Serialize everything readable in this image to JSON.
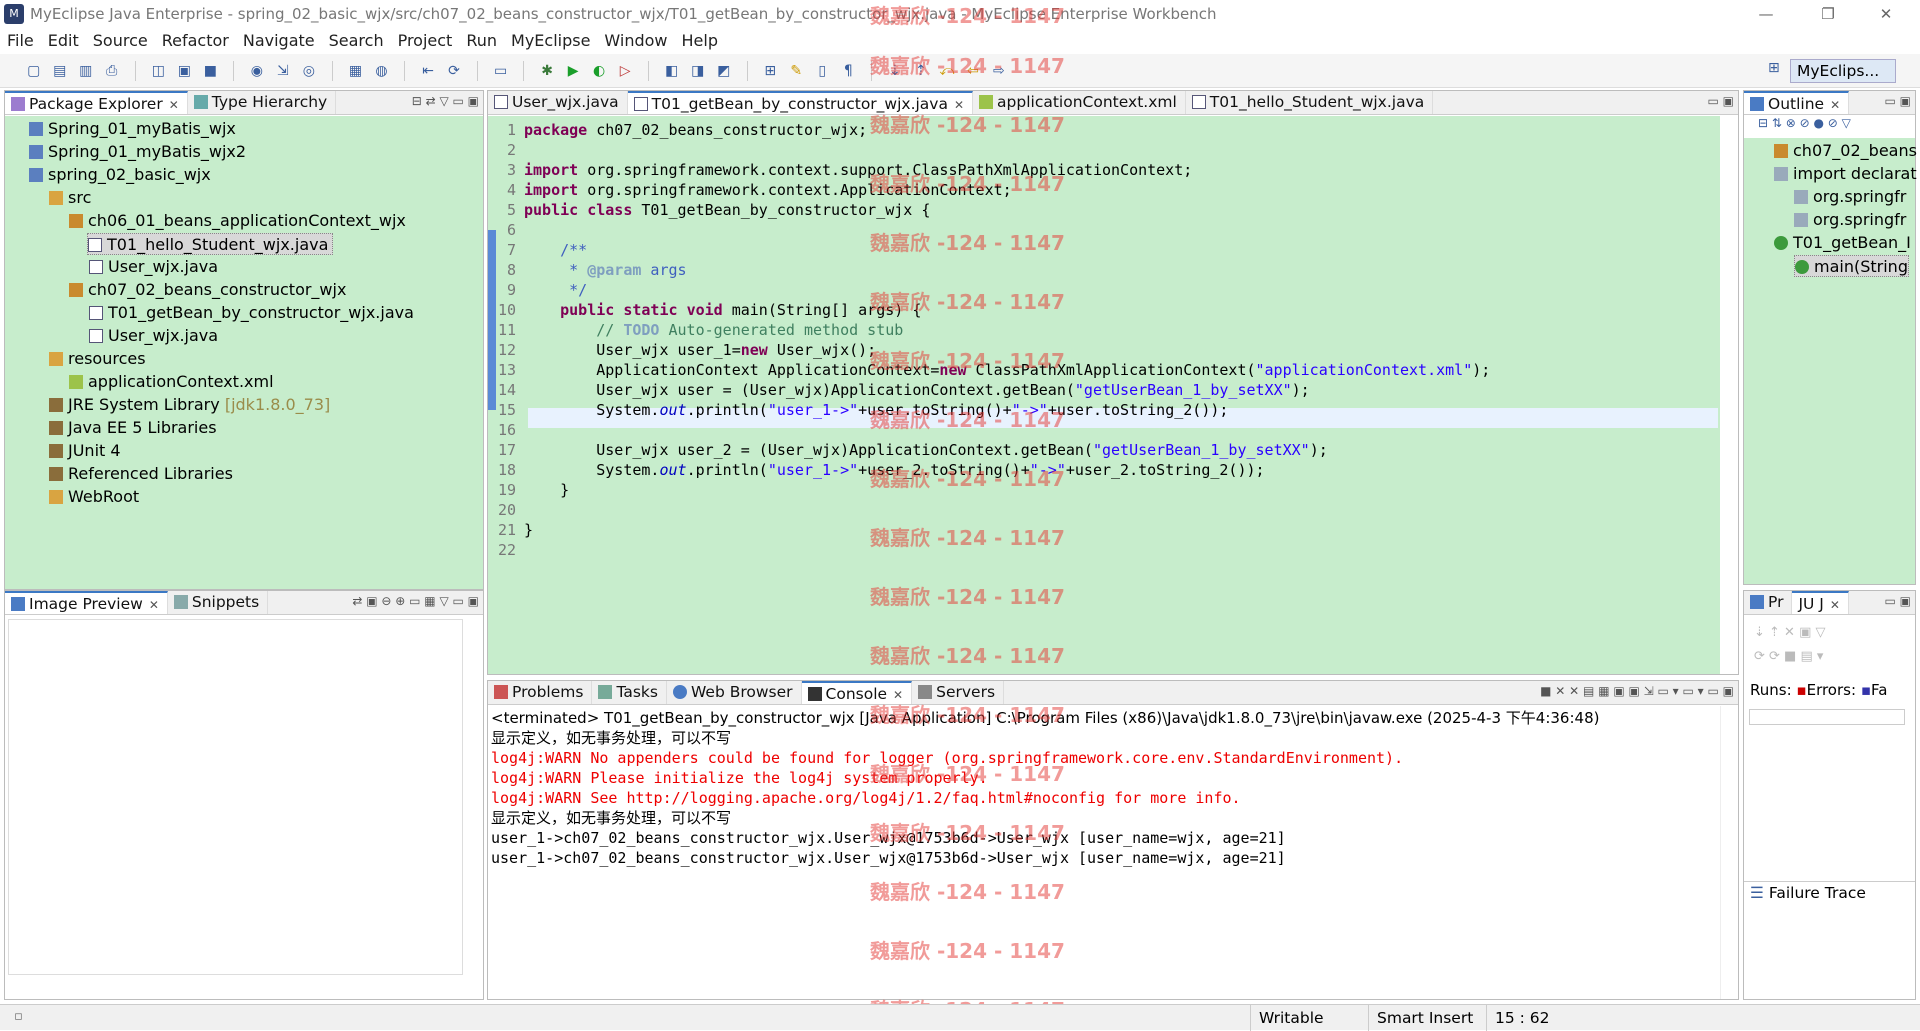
{
  "window": {
    "title": "MyEclipse Java Enterprise - spring_02_basic_wjx/src/ch07_02_beans_constructor_wjx/T01_getBean_by_constructor_wjx.java - MyEclipse Enterprise Workbench",
    "minimize": "—",
    "restore": "❐",
    "close": "✕"
  },
  "menu": [
    "File",
    "Edit",
    "Source",
    "Refactor",
    "Navigate",
    "Search",
    "Project",
    "Run",
    "MyEclipse",
    "Window",
    "Help"
  ],
  "perspective": "MyEclips...",
  "package_explorer": {
    "tabs": [
      "Package Explorer",
      "Type Hierarchy"
    ],
    "items": [
      {
        "label": "Spring_01_myBatis_wjx",
        "suffix": ""
      },
      {
        "label": "Spring_01_myBatis_wjx2",
        "suffix": ""
      },
      {
        "label": "spring_02_basic_wjx",
        "suffix": ""
      },
      {
        "label": "src",
        "suffix": ""
      },
      {
        "label": "ch06_01_beans_applicationContext_wjx",
        "suffix": ""
      },
      {
        "label": "T01_hello_Student_wjx.java",
        "suffix": ""
      },
      {
        "label": "User_wjx.java",
        "suffix": ""
      },
      {
        "label": "ch07_02_beans_constructor_wjx",
        "suffix": ""
      },
      {
        "label": "T01_getBean_by_constructor_wjx.java",
        "suffix": ""
      },
      {
        "label": "User_wjx.java",
        "suffix": ""
      },
      {
        "label": "resources",
        "suffix": ""
      },
      {
        "label": "applicationContext.xml",
        "suffix": ""
      },
      {
        "label": "JRE System Library",
        "suffix": "[jdk1.8.0_73]"
      },
      {
        "label": "Java EE 5 Libraries",
        "suffix": ""
      },
      {
        "label": "JUnit 4",
        "suffix": ""
      },
      {
        "label": "Referenced Libraries",
        "suffix": ""
      },
      {
        "label": "WebRoot",
        "suffix": ""
      }
    ]
  },
  "image_preview": {
    "tabs": [
      "Image Preview",
      "Snippets"
    ]
  },
  "editor": {
    "tabs": [
      "User_wjx.java",
      "T01_getBean_by_constructor_wjx.java",
      "applicationContext.xml",
      "T01_hello_Student_wjx.java"
    ],
    "lines": [
      "1",
      "2",
      "3",
      "4",
      "5",
      "6",
      "7",
      "8",
      "9",
      "10",
      "11",
      "12",
      "13",
      "14",
      "15",
      "16",
      "17",
      "18",
      "19",
      "20",
      "21",
      "22"
    ],
    "code": {
      "l1_kw": "package",
      "l1_rest": " ch07_02_beans_constructor_wjx;",
      "l3_kw": "import",
      "l3_rest": " org.springframework.context.support.ClassPathXmlApplicationContext;",
      "l4_kw": "import",
      "l4_rest": " org.springframework.context.ApplicationContext;",
      "l5_kw1": "public",
      "l5_kw2": "class",
      "l5_rest": " T01_getBean_by_constructor_wjx {",
      "l7": "    /**",
      "l8_a": "     * ",
      "l8_tag": "@param",
      "l8_b": " args",
      "l9": "     */",
      "l10_kw1": "public",
      "l10_kw2": "static",
      "l10_kw3": "void",
      "l10_rest": " main(String[] args) {",
      "l11_a": "        // ",
      "l11_todo": "TODO",
      "l11_b": " Auto-generated method stub",
      "l12_a": "        User_wjx user_1=",
      "l12_kw": "new",
      "l12_b": " User_wjx();",
      "l13_a": "        ApplicationContext ApplicationContext=",
      "l13_kw": "new",
      "l13_b": " ClassPathXmlApplicationContext(",
      "l13_s": "\"applicationContext.xml\"",
      "l13_c": ");",
      "l14_a": "        User_wjx user = (User_wjx)ApplicationContext.getBean(",
      "l14_s": "\"getUserBean_1_by_setXX\"",
      "l14_c": ");",
      "l15_a": "        System.",
      "l15_f": "out",
      "l15_b": ".println(",
      "l15_s1": "\"user_1->\"",
      "l15_c": "+user.toString()+",
      "l15_s2": "\"->\"",
      "l15_d": "+user.toString_2());",
      "l17_a": "        User_wjx user_2 = (User_wjx)ApplicationContext.getBean(",
      "l17_s": "\"getUserBean_1_by_setXX\"",
      "l17_c": ");",
      "l18_a": "        System.",
      "l18_f": "out",
      "l18_b": ".println(",
      "l18_s1": "\"user_1->\"",
      "l18_c": "+user_2.toString()+",
      "l18_s2": "\"->\"",
      "l18_d": "+user_2.toString_2());",
      "l19": "    }",
      "l21": "}"
    }
  },
  "outline": {
    "tabs": [
      "Outline"
    ],
    "items": [
      "ch07_02_beans",
      "import declarat",
      "org.springfr",
      "org.springfr",
      "T01_getBean_I",
      "main(String"
    ]
  },
  "junit": {
    "tabs": [
      "Pr",
      "JU J"
    ],
    "runs_label": "Runs:",
    "errors_label": "Errors:",
    "failures_label": "Fa",
    "failure_trace": "Failure Trace"
  },
  "console": {
    "tabs": [
      "Problems",
      "Tasks",
      "Web Browser",
      "Console",
      "Servers"
    ],
    "header": "<terminated> T01_getBean_by_constructor_wjx [Java Application] C:\\Program Files (x86)\\Java\\jdk1.8.0_73\\jre\\bin\\javaw.exe (2025-4-3 下午4:36:48)",
    "lines": [
      {
        "text": "显示定义，如无事务处理，可以不写",
        "kind": "normal"
      },
      {
        "text": "log4j:WARN No appenders could be found for logger (org.springframework.core.env.StandardEnvironment).",
        "kind": "err"
      },
      {
        "text": "log4j:WARN Please initialize the log4j system properly.",
        "kind": "err"
      },
      {
        "text": "log4j:WARN See http://logging.apache.org/log4j/1.2/faq.html#noconfig for more info.",
        "kind": "err"
      },
      {
        "text": "显示定义，如无事务处理，可以不写",
        "kind": "normal"
      },
      {
        "text": "user_1->ch07_02_beans_constructor_wjx.User_wjx@1753b6d->User_wjx [user_name=wjx, age=21]",
        "kind": "normal"
      },
      {
        "text": "user_1->ch07_02_beans_constructor_wjx.User_wjx@1753b6d->User_wjx [user_name=wjx, age=21]",
        "kind": "normal"
      }
    ]
  },
  "watermark": "魏嘉欣 -124 - 1147",
  "status": {
    "writable": "Writable",
    "insert": "Smart Insert",
    "position": "15 : 62"
  },
  "colors": {
    "editor_bg": "#c7edcc",
    "error_text": "#e00000",
    "watermark": "#e53935",
    "keyword": "#7f0055",
    "string": "#2a00ff"
  }
}
